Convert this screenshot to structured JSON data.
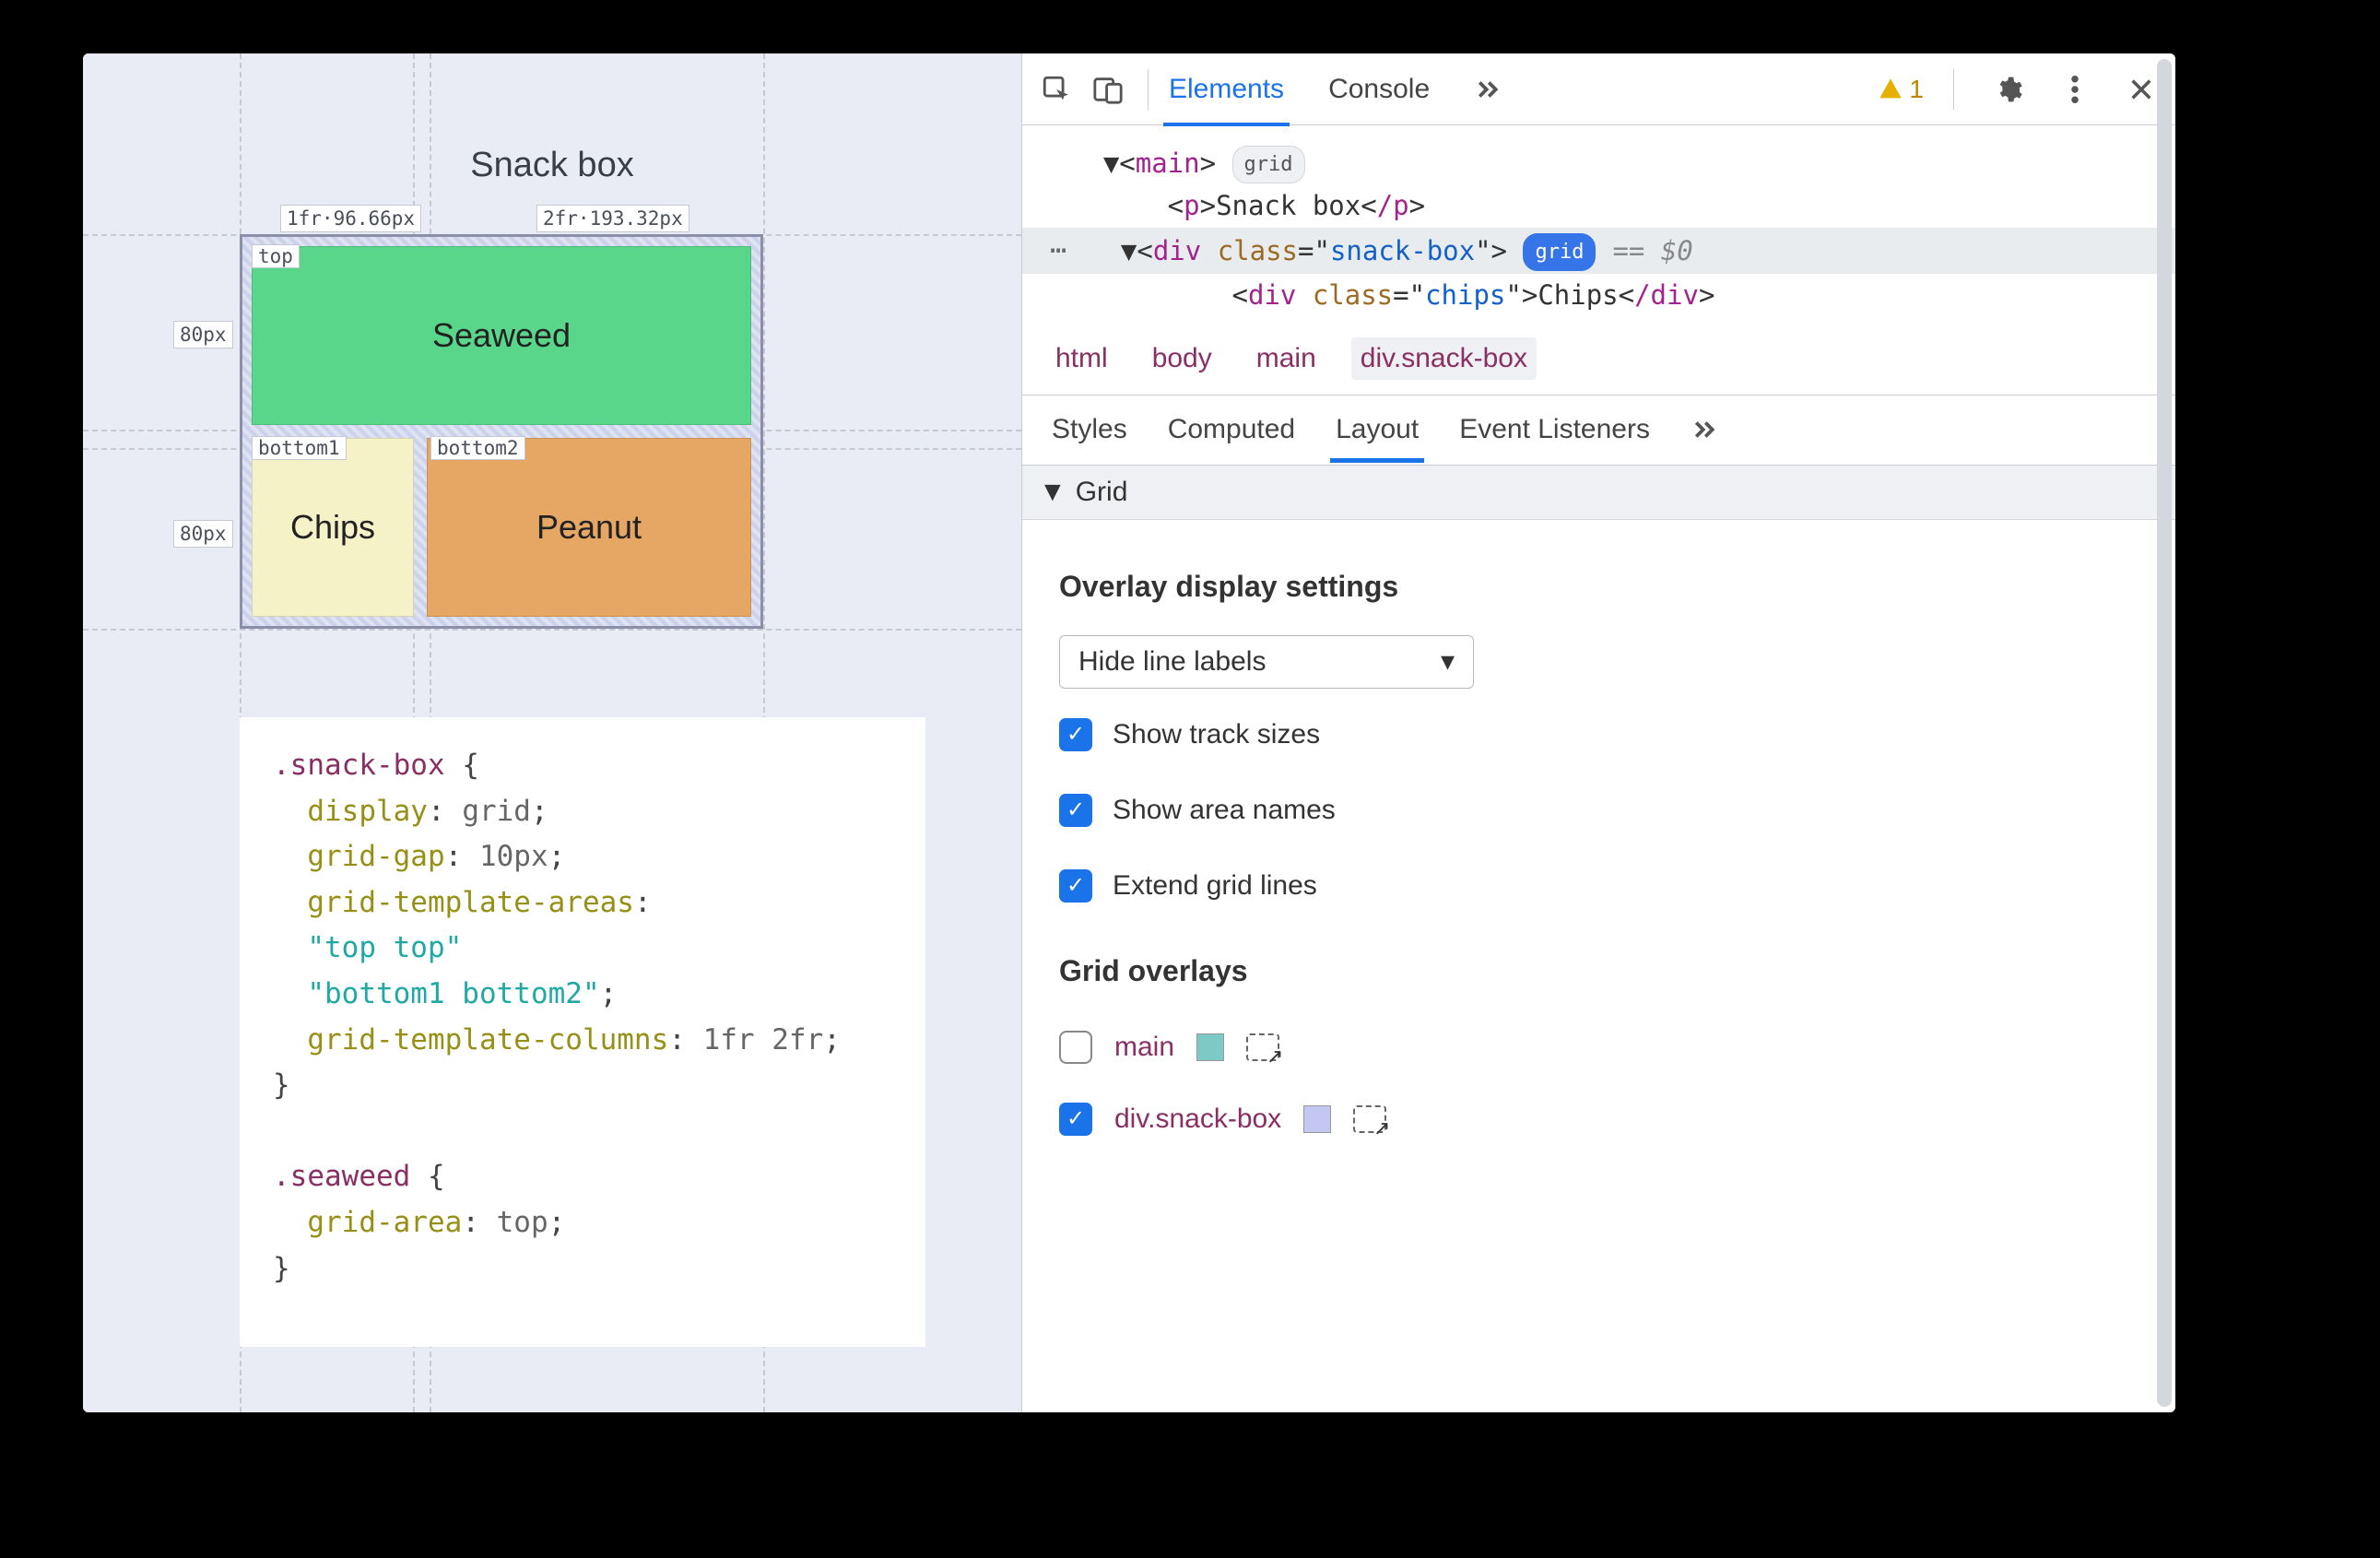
{
  "preview": {
    "title": "Snack box",
    "tracks": {
      "col1": "1fr·96.66px",
      "col2": "2fr·193.32px",
      "rowSize": "80px"
    },
    "areas": {
      "top": "top",
      "b1": "bottom1",
      "b2": "bottom2"
    },
    "cells": {
      "seaweed": "Seaweed",
      "chips": "Chips",
      "peanut": "Peanut"
    },
    "code": {
      "sel1": ".snack-box",
      "l1p": "display",
      "l1v": "grid",
      "l2p": "grid-gap",
      "l2v": "10px",
      "l3p": "grid-template-areas",
      "l3v1": "\"top top\"",
      "l3v2": "\"bottom1 bottom2\"",
      "l4p": "grid-template-columns",
      "l4v": "1fr 2fr",
      "sel2": ".seaweed",
      "l5p": "grid-area",
      "l5v": "top"
    }
  },
  "devtools": {
    "tabs": {
      "elements": "Elements",
      "console": "Console"
    },
    "warnings": "1",
    "dom": {
      "mainOpen": "main",
      "gridBadge": "grid",
      "pOpen": "p",
      "pText": "Snack box",
      "pClose": "/p",
      "divOpen": "div",
      "class": "class",
      "snack": "snack-box",
      "eq0": "== $0",
      "chipsClass": "chips",
      "chipsText": "Chips",
      "divClose": "/div"
    },
    "crumbs": [
      "html",
      "body",
      "main",
      "div.snack-box"
    ],
    "subtabs": [
      "Styles",
      "Computed",
      "Layout",
      "Event Listeners"
    ],
    "section": "Grid",
    "overlay": {
      "title": "Overlay display settings",
      "selectLabel": "Hide line labels",
      "showTrack": "Show track sizes",
      "showArea": "Show area names",
      "extend": "Extend grid lines"
    },
    "layers": {
      "title": "Grid overlays",
      "main": "main",
      "snack": "div.snack-box"
    }
  }
}
